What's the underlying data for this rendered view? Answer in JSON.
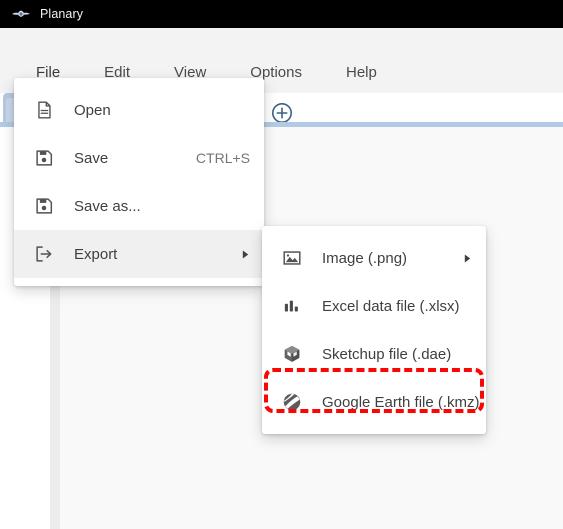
{
  "window": {
    "title": "Planary",
    "logo_icon": "planary-wings-logo"
  },
  "menubar": {
    "items": [
      {
        "label": "File",
        "active": true
      },
      {
        "label": "Edit",
        "active": false
      },
      {
        "label": "View",
        "active": false
      },
      {
        "label": "Options",
        "active": false
      },
      {
        "label": "Help",
        "active": false
      }
    ]
  },
  "tabstrip": {
    "add_tab_icon": "plus-circle-icon",
    "accent_color": "#b3cae4"
  },
  "file_menu": {
    "items": [
      {
        "label": "Open",
        "icon": "document-icon",
        "shortcut": "",
        "arrow": false,
        "highlight": false
      },
      {
        "label": "Save",
        "icon": "floppy-disk-icon",
        "shortcut": "CTRL+S",
        "arrow": false,
        "highlight": false
      },
      {
        "label": "Save as...",
        "icon": "floppy-disk-icon",
        "shortcut": "",
        "arrow": false,
        "highlight": false
      },
      {
        "label": "Export",
        "icon": "export-arrow-icon",
        "shortcut": "",
        "arrow": true,
        "highlight": true
      }
    ]
  },
  "export_menu": {
    "items": [
      {
        "label": "Image (.png)",
        "icon": "image-icon",
        "arrow": true,
        "selected": false
      },
      {
        "label": "Excel data file (.xlsx)",
        "icon": "bar-chart-icon",
        "arrow": false,
        "selected": false
      },
      {
        "label": "Sketchup file (.dae)",
        "icon": "sketchup-icon",
        "arrow": false,
        "selected": false
      },
      {
        "label": "Google Earth file (.kmz)",
        "icon": "google-earth-icon",
        "arrow": false,
        "selected": true
      }
    ],
    "highlight_color": "#fb0505"
  }
}
